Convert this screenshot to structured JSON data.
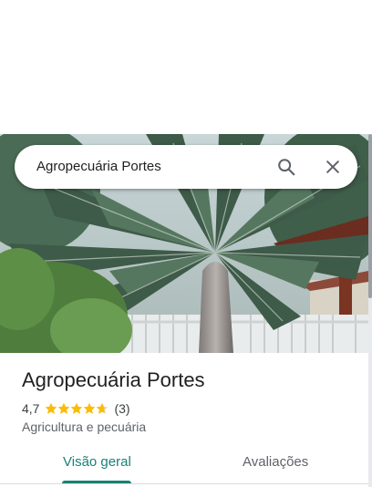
{
  "search": {
    "query": "Agropecuária Portes",
    "search_icon": "search-icon",
    "close_icon": "close-icon"
  },
  "place": {
    "name": "Agropecuária Portes",
    "rating": "4,7",
    "rating_value": 4.7,
    "rating_max": 5,
    "reviews_count": "(3)",
    "category": "Agricultura e pecuária"
  },
  "tabs": [
    {
      "label": "Visão geral",
      "active": true
    },
    {
      "label": "Avaliações",
      "active": false
    }
  ],
  "colors": {
    "accent": "#188176",
    "star": "#fbbc04",
    "star_empty": "#dadce0"
  }
}
